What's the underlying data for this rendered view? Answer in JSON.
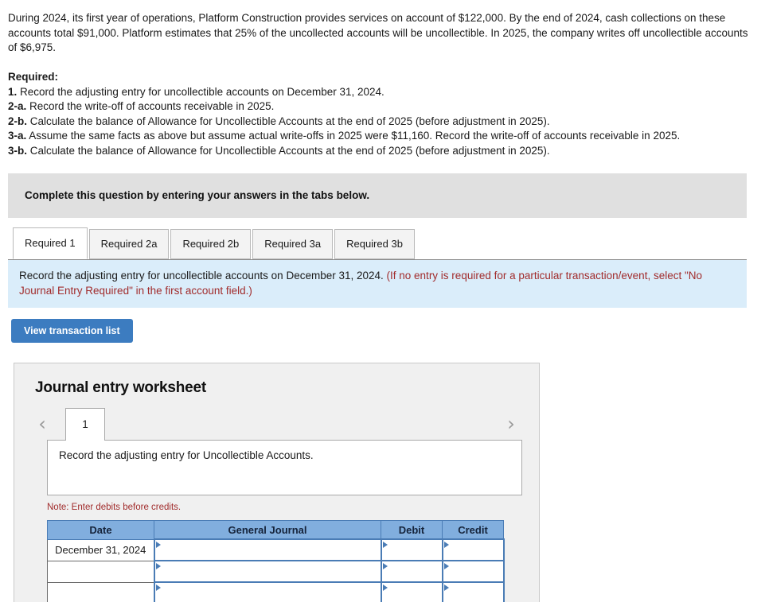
{
  "problem": {
    "statement": "During 2024, its first year of operations, Platform Construction provides services on account of $122,000. By the end of 2024, cash collections on these accounts total $91,000. Platform estimates that 25% of the uncollected accounts will be uncollectible. In 2025, the company writes off uncollectible accounts of $6,975."
  },
  "required": {
    "heading": "Required:",
    "items": [
      {
        "num": "1.",
        "text": " Record the adjusting entry for uncollectible accounts on December 31, 2024."
      },
      {
        "num": "2-a.",
        "text": " Record the write-off of accounts receivable in 2025."
      },
      {
        "num": "2-b.",
        "text": " Calculate the balance of Allowance for Uncollectible Accounts at the end of 2025 (before adjustment in 2025)."
      },
      {
        "num": "3-a.",
        "text": " Assume the same facts as above but assume actual write-offs in 2025 were $11,160. Record the write-off of accounts receivable in 2025."
      },
      {
        "num": "3-b.",
        "text": " Calculate the balance of Allowance for Uncollectible Accounts at the end of 2025 (before adjustment in 2025)."
      }
    ]
  },
  "banner": {
    "text": "Complete this question by entering your answers in the tabs below."
  },
  "tabs": [
    {
      "label": "Required 1",
      "active": true
    },
    {
      "label": "Required 2a",
      "active": false
    },
    {
      "label": "Required 2b",
      "active": false
    },
    {
      "label": "Required 3a",
      "active": false
    },
    {
      "label": "Required 3b",
      "active": false
    }
  ],
  "info_box": {
    "main": "Record the adjusting entry for uncollectible accounts on December 31, 2024. ",
    "hint": "(If no entry is required for a particular transaction/event, select \"No Journal Entry Required\" in the first account field.)"
  },
  "buttons": {
    "view_transaction_list": "View transaction list"
  },
  "worksheet": {
    "title": "Journal entry worksheet",
    "pager": {
      "prev_icon": "chevron-left",
      "next_icon": "chevron-right",
      "pages": [
        "1"
      ],
      "active_page": "1"
    },
    "entry_description": "Record the adjusting entry for Uncollectible Accounts.",
    "note": "Note: Enter debits before credits.",
    "table": {
      "headers": [
        "Date",
        "General Journal",
        "Debit",
        "Credit"
      ],
      "rows": [
        {
          "date": "December 31, 2024",
          "general_journal": "",
          "debit": "",
          "credit": ""
        },
        {
          "date": "",
          "general_journal": "",
          "debit": "",
          "credit": ""
        },
        {
          "date": "",
          "general_journal": "",
          "debit": "",
          "credit": ""
        }
      ]
    }
  },
  "colors": {
    "banner_gray": "#e0e0e0",
    "info_blue": "#daedfa",
    "hint_red": "#a12c2c",
    "button_blue": "#3c7cc0",
    "table_header_blue": "#81aede",
    "input_border_blue": "#4a7cb5",
    "panel_gray": "#f0f0f0"
  }
}
